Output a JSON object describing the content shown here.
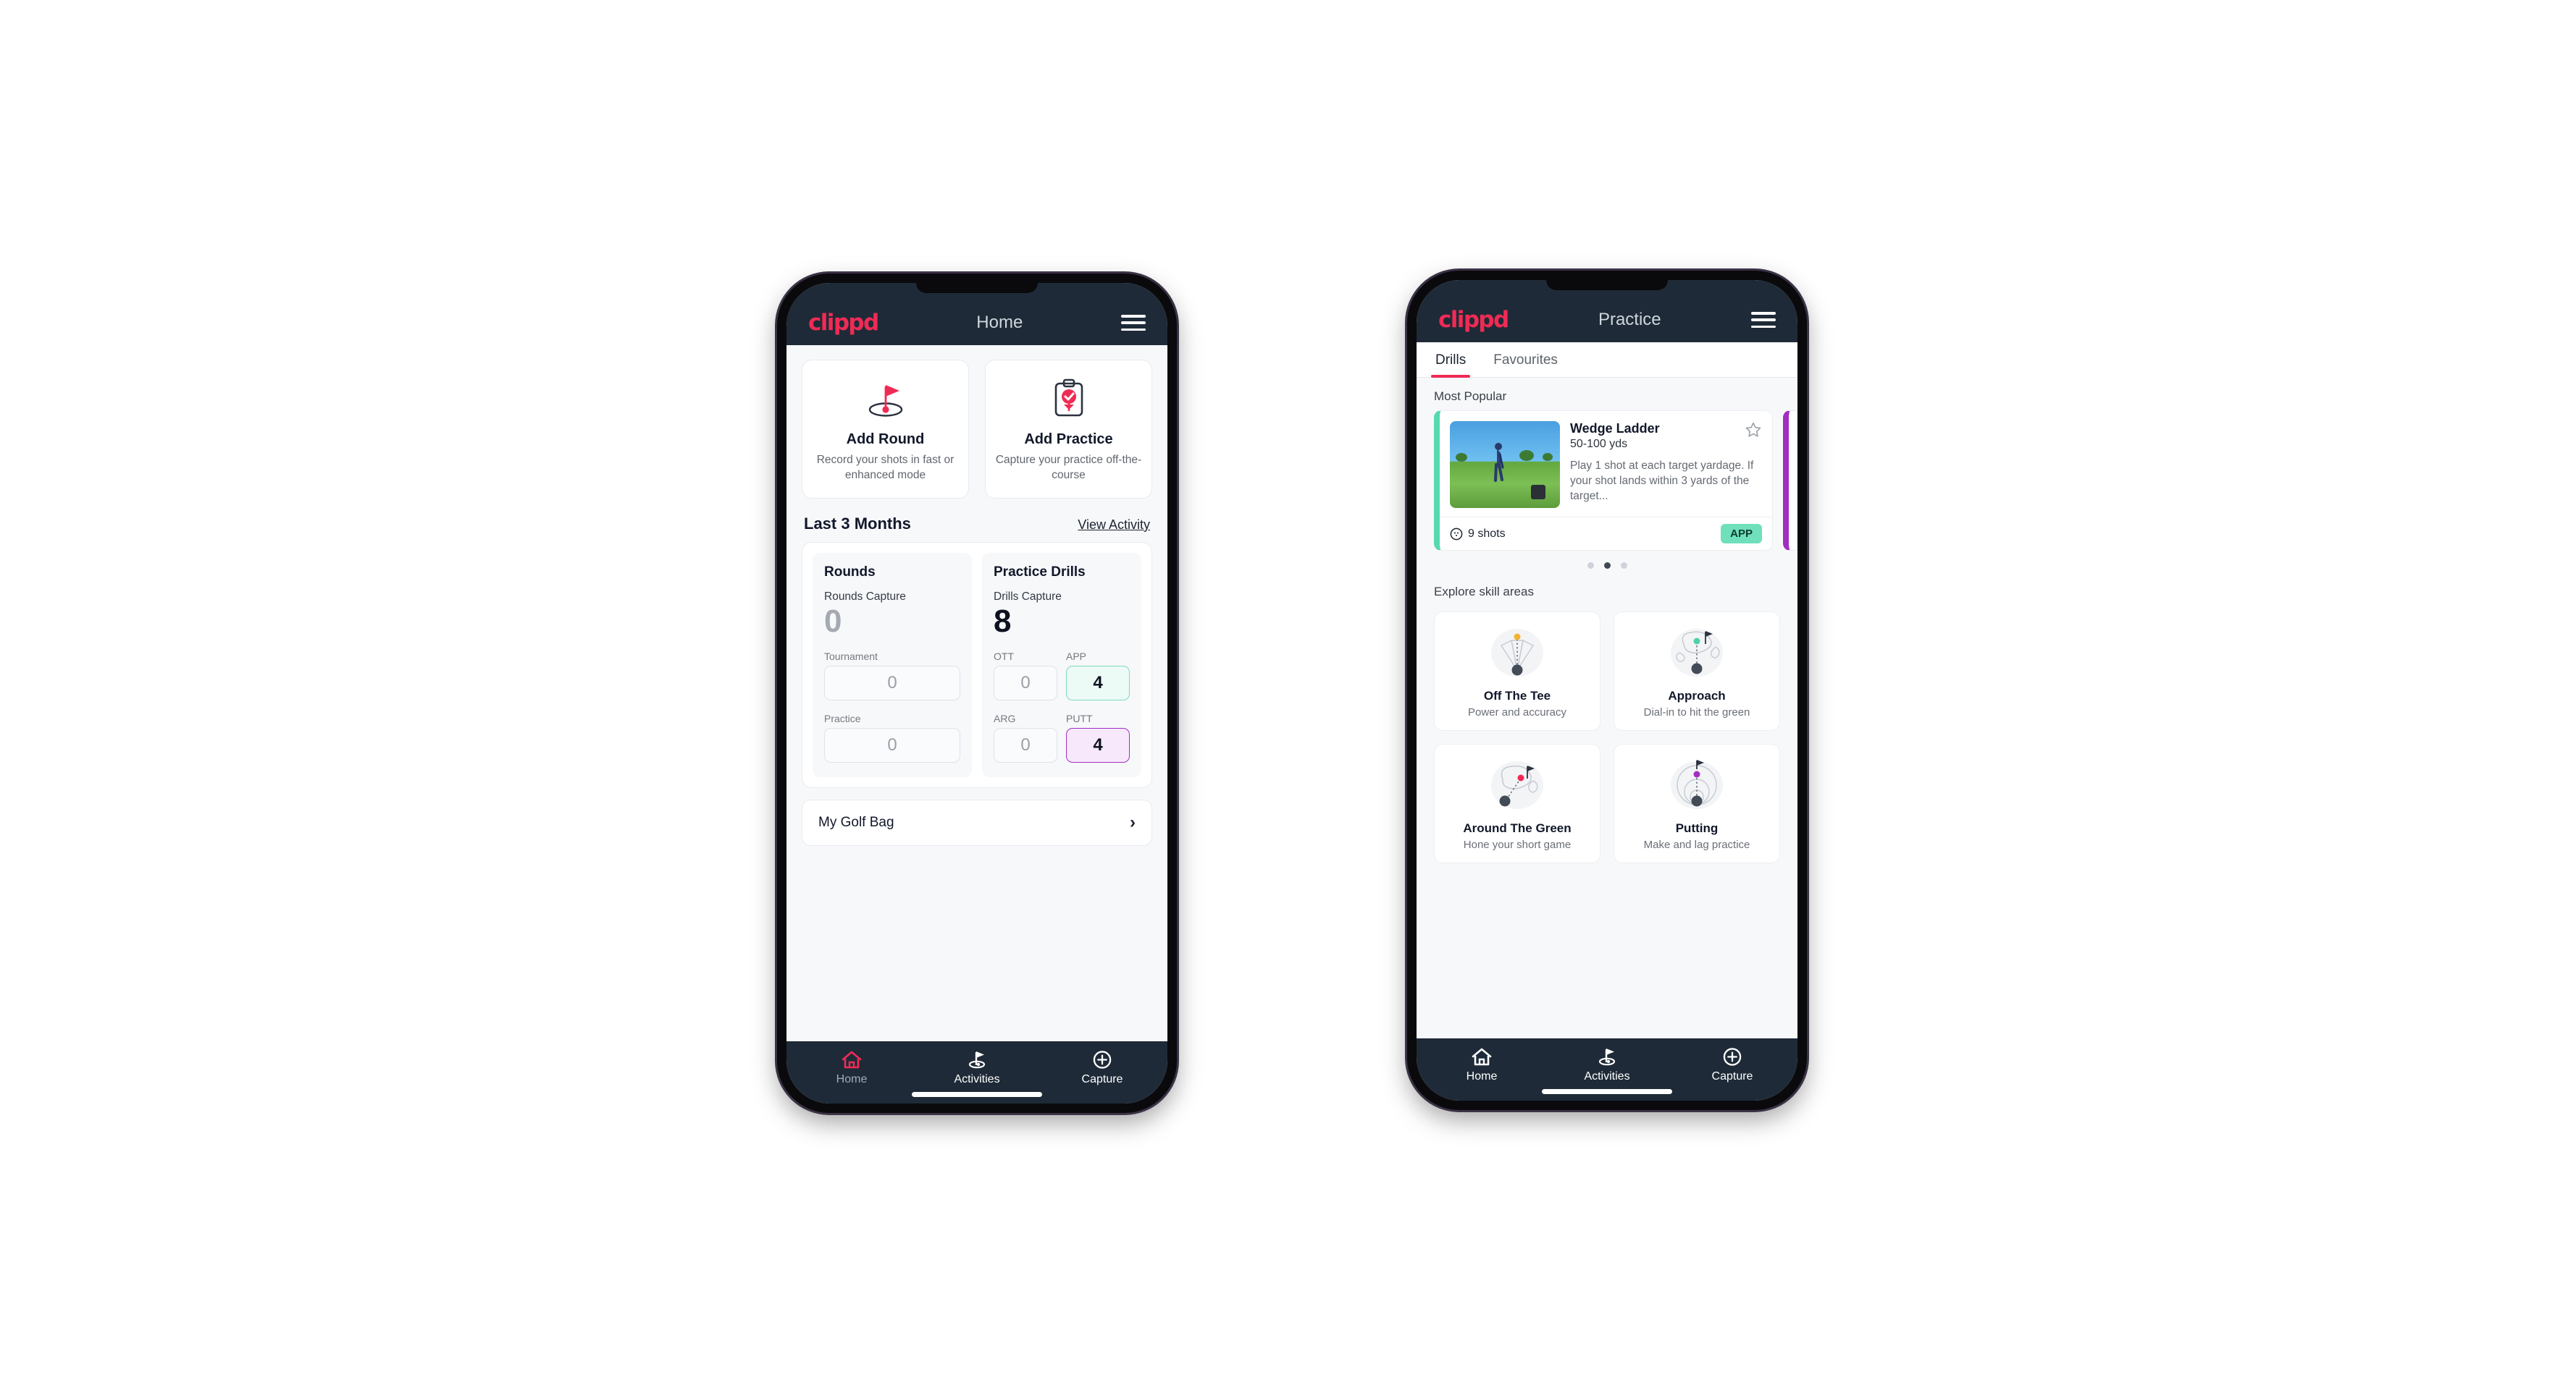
{
  "colors": {
    "brand_pink": "#ef2b55",
    "appbar_dark": "#1e2a37",
    "accent_green": "#6fe0bb",
    "accent_purple": "#a22ec0",
    "page_bg": "#f7f8fa"
  },
  "home_phone": {
    "appbar": {
      "logo": "clippd",
      "title": "Home",
      "menu_icon": "hamburger-menu-icon"
    },
    "quick_actions": [
      {
        "icon": "golf-flag-pin-icon",
        "title": "Add Round",
        "subtitle": "Record your shots in fast or enhanced mode"
      },
      {
        "icon": "clipboard-check-icon",
        "title": "Add Practice",
        "subtitle": "Capture your practice off-the-course"
      }
    ],
    "section": {
      "title": "Last 3 Months",
      "link": "View Activity"
    },
    "rounds": {
      "heading": "Rounds",
      "capture_label": "Rounds Capture",
      "capture_value": "0",
      "fields": [
        {
          "label": "Tournament",
          "value": "0",
          "accent": "none"
        },
        {
          "label": "Practice",
          "value": "0",
          "accent": "none"
        }
      ]
    },
    "drills": {
      "heading": "Practice Drills",
      "capture_label": "Drills Capture",
      "capture_value": "8",
      "fields": [
        {
          "label": "OTT",
          "value": "0",
          "accent": "none"
        },
        {
          "label": "APP",
          "value": "4",
          "accent": "green"
        },
        {
          "label": "ARG",
          "value": "0",
          "accent": "none"
        },
        {
          "label": "PUTT",
          "value": "4",
          "accent": "purple"
        }
      ]
    },
    "golf_bag": {
      "label": "My Golf Bag",
      "chevron": "chevron-right-icon"
    },
    "bottom_nav": [
      {
        "icon": "home-icon",
        "label": "Home",
        "active": true
      },
      {
        "icon": "golf-flag-icon",
        "label": "Activities",
        "active": false
      },
      {
        "icon": "plus-circle-icon",
        "label": "Capture",
        "active": false
      }
    ]
  },
  "practice_phone": {
    "appbar": {
      "logo": "clippd",
      "title": "Practice",
      "menu_icon": "hamburger-menu-icon"
    },
    "tabs": [
      {
        "label": "Drills",
        "active": true
      },
      {
        "label": "Favourites",
        "active": false
      }
    ],
    "most_popular_label": "Most Popular",
    "drill_card": {
      "title": "Wedge Ladder",
      "distance": "50-100 yds",
      "description": "Play 1 shot at each target yardage. If your shot lands within 3 yards of the target...",
      "shots": "9 shots",
      "shots_icon": "golf-ball-icon",
      "badge": "APP",
      "favourite_icon": "star-outline-icon",
      "thumbnail": "golfer-wedge-shot-photo"
    },
    "carousel_dots": {
      "count": 3,
      "active_index": 1
    },
    "skill_areas_label": "Explore skill areas",
    "skill_areas": [
      {
        "name": "Off The Tee",
        "subtitle": "Power and accuracy",
        "art": "tee-dispersion-fan-icon"
      },
      {
        "name": "Approach",
        "subtitle": "Dial-in to hit the green",
        "art": "green-approach-icon"
      },
      {
        "name": "Around The Green",
        "subtitle": "Hone your short game",
        "art": "chip-around-green-icon"
      },
      {
        "name": "Putting",
        "subtitle": "Make and lag practice",
        "art": "putting-rings-icon"
      }
    ],
    "bottom_nav": [
      {
        "icon": "home-icon",
        "label": "Home",
        "active": false
      },
      {
        "icon": "golf-flag-icon",
        "label": "Activities",
        "active": false
      },
      {
        "icon": "plus-circle-icon",
        "label": "Capture",
        "active": false
      }
    ]
  }
}
